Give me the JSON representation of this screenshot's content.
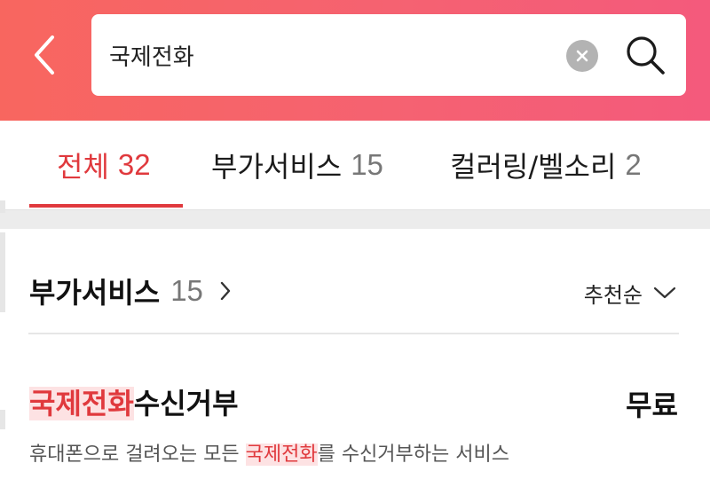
{
  "search": {
    "query": "국제전화",
    "placeholder": ""
  },
  "icons": {
    "back": "back-arrow-icon",
    "clear": "clear-x-icon",
    "search": "search-icon",
    "chevron_right": "chevron-right-icon",
    "chevron_down": "chevron-down-icon"
  },
  "colors": {
    "header_start": "#f8665f",
    "header_end": "#f45a7c",
    "accent": "#e0393d",
    "highlight_bg": "#fde2e3"
  },
  "tabs": [
    {
      "label": "전체",
      "count": "32",
      "active": true
    },
    {
      "label": "부가서비스",
      "count": "15",
      "active": false
    },
    {
      "label": "컬러링/벨소리",
      "count": "2",
      "active": false
    }
  ],
  "section": {
    "title": "부가서비스",
    "count": "15",
    "sort_label": "추천순"
  },
  "items": [
    {
      "title_highlight": "국제전화",
      "title_rest": "수신거부",
      "price": "무료",
      "desc_before": "휴대폰으로 걸려오는 모든 ",
      "desc_highlight": "국제전화",
      "desc_after": "를 수신거부하는 서비스"
    }
  ]
}
